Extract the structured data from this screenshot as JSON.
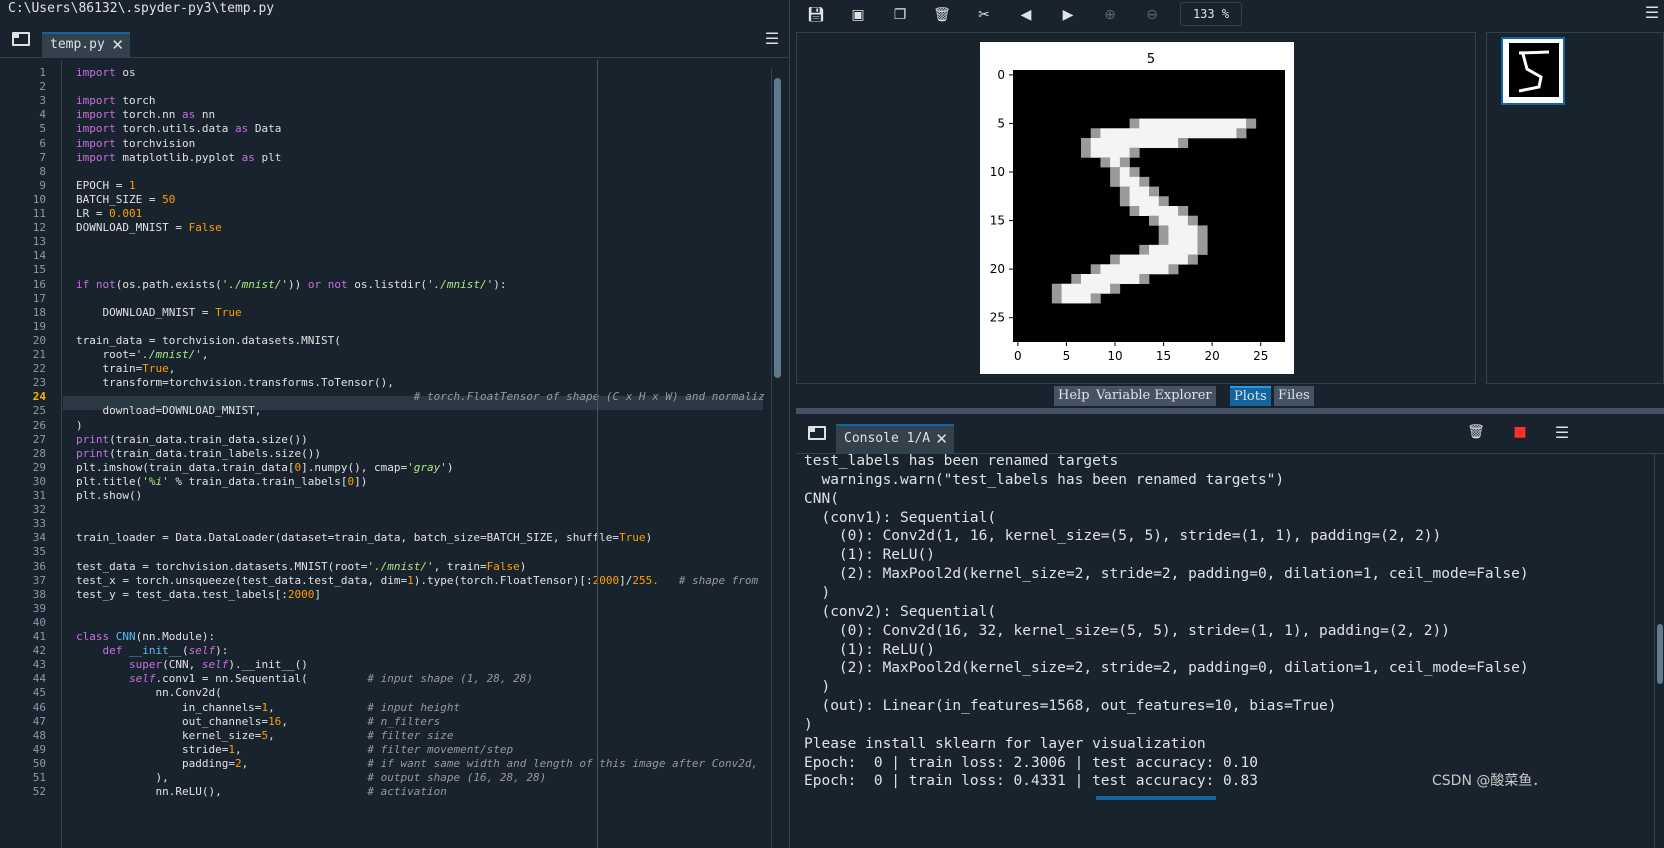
{
  "editor": {
    "path": "C:\\Users\\86132\\.spyder-py3\\temp.py",
    "tab_label": "temp.py",
    "current_line": 24,
    "lines": [
      [
        {
          "t": "import",
          "c": "kw"
        },
        {
          "t": " os"
        }
      ],
      [],
      [
        {
          "t": "import",
          "c": "kw"
        },
        {
          "t": " torch"
        }
      ],
      [
        {
          "t": "import",
          "c": "kw"
        },
        {
          "t": " torch.nn "
        },
        {
          "t": "as",
          "c": "kw"
        },
        {
          "t": " nn"
        }
      ],
      [
        {
          "t": "import",
          "c": "kw"
        },
        {
          "t": " torch.utils.data "
        },
        {
          "t": "as",
          "c": "kw"
        },
        {
          "t": " Data"
        }
      ],
      [
        {
          "t": "import",
          "c": "kw"
        },
        {
          "t": " torchvision"
        }
      ],
      [
        {
          "t": "import",
          "c": "kw"
        },
        {
          "t": " matplotlib.pyplot "
        },
        {
          "t": "as",
          "c": "kw"
        },
        {
          "t": " plt"
        }
      ],
      [],
      [
        {
          "t": "EPOCH = "
        },
        {
          "t": "1",
          "c": "num"
        }
      ],
      [
        {
          "t": "BATCH_SIZE = "
        },
        {
          "t": "50",
          "c": "num"
        }
      ],
      [
        {
          "t": "LR = "
        },
        {
          "t": "0.001",
          "c": "num"
        }
      ],
      [
        {
          "t": "DOWNLOAD_MNIST = "
        },
        {
          "t": "False",
          "c": "num"
        }
      ],
      [],
      [],
      [],
      [
        {
          "t": "if",
          "c": "kw"
        },
        {
          "t": " "
        },
        {
          "t": "not",
          "c": "kw"
        },
        {
          "t": "(os.path.exists("
        },
        {
          "t": "'./mnist/'",
          "c": "str"
        },
        {
          "t": ")) "
        },
        {
          "t": "or",
          "c": "kw"
        },
        {
          "t": " "
        },
        {
          "t": "not",
          "c": "kw"
        },
        {
          "t": " os.listdir("
        },
        {
          "t": "'./mnist/'",
          "c": "str"
        },
        {
          "t": "):"
        }
      ],
      [],
      [
        {
          "t": "    DOWNLOAD_MNIST = "
        },
        {
          "t": "True",
          "c": "num"
        }
      ],
      [],
      [
        {
          "t": "train_data = torchvision.datasets.MNIST("
        }
      ],
      [
        {
          "t": "    root="
        },
        {
          "t": "'./mnist/'",
          "c": "str"
        },
        {
          "t": ","
        }
      ],
      [
        {
          "t": "    train="
        },
        {
          "t": "True",
          "c": "num"
        },
        {
          "t": ","
        }
      ],
      [
        {
          "t": "    transform=torchvision.transforms.ToTensor(),"
        }
      ],
      [
        {
          "t": "                                                   "
        },
        {
          "t": "# torch.FloatTensor of shape (C x H x W) and normaliz",
          "c": "cm"
        }
      ],
      [
        {
          "t": "    download=DOWNLOAD_MNIST,"
        }
      ],
      [
        {
          "t": ")"
        }
      ],
      [
        {
          "t": "print",
          "c": "kw"
        },
        {
          "t": "(train_data.train_data.size())"
        }
      ],
      [
        {
          "t": "print",
          "c": "kw"
        },
        {
          "t": "(train_data.train_labels.size())"
        }
      ],
      [
        {
          "t": "plt.imshow(train_data.train_data["
        },
        {
          "t": "0",
          "c": "num"
        },
        {
          "t": "].numpy(), cmap="
        },
        {
          "t": "'gray'",
          "c": "str"
        },
        {
          "t": ")"
        }
      ],
      [
        {
          "t": "plt.title("
        },
        {
          "t": "'%i'",
          "c": "str"
        },
        {
          "t": " % train_data.train_labels["
        },
        {
          "t": "0",
          "c": "num"
        },
        {
          "t": "])"
        }
      ],
      [
        {
          "t": "plt.show()"
        }
      ],
      [],
      [],
      [
        {
          "t": "train_loader = Data.DataLoader(dataset=train_data, batch_size=BATCH_SIZE, shuffle="
        },
        {
          "t": "True",
          "c": "num"
        },
        {
          "t": ")"
        }
      ],
      [],
      [
        {
          "t": "test_data = torchvision.datasets.MNIST(root="
        },
        {
          "t": "'./mnist/'",
          "c": "str"
        },
        {
          "t": ", train="
        },
        {
          "t": "False",
          "c": "num"
        },
        {
          "t": ")"
        }
      ],
      [
        {
          "t": "test_x = torch.unsqueeze(test_data.test_data, dim="
        },
        {
          "t": "1",
          "c": "num"
        },
        {
          "t": ").type(torch.FloatTensor)[:"
        },
        {
          "t": "2000",
          "c": "num"
        },
        {
          "t": "]/"
        },
        {
          "t": "255.",
          "c": "num"
        },
        {
          "t": "   "
        },
        {
          "t": "# shape from",
          "c": "cm"
        }
      ],
      [
        {
          "t": "test_y = test_data.test_labels[:"
        },
        {
          "t": "2000",
          "c": "num"
        },
        {
          "t": "]"
        }
      ],
      [],
      [],
      [
        {
          "t": "class",
          "c": "kw"
        },
        {
          "t": " "
        },
        {
          "t": "CNN",
          "c": "cls"
        },
        {
          "t": "(nn.Module):"
        }
      ],
      [
        {
          "t": "    "
        },
        {
          "t": "def",
          "c": "kw"
        },
        {
          "t": " "
        },
        {
          "t": "__init__",
          "c": "cls"
        },
        {
          "t": "("
        },
        {
          "t": "self",
          "c": "self"
        },
        {
          "t": "):"
        }
      ],
      [
        {
          "t": "        "
        },
        {
          "t": "super",
          "c": "kw"
        },
        {
          "t": "(CNN, "
        },
        {
          "t": "self",
          "c": "self"
        },
        {
          "t": ").__init__()"
        }
      ],
      [
        {
          "t": "        "
        },
        {
          "t": "self",
          "c": "self"
        },
        {
          "t": ".conv1 = nn.Sequential(         "
        },
        {
          "t": "# input shape (1, 28, 28)",
          "c": "cm"
        }
      ],
      [
        {
          "t": "            nn.Conv2d("
        }
      ],
      [
        {
          "t": "                in_channels="
        },
        {
          "t": "1",
          "c": "num"
        },
        {
          "t": ",              "
        },
        {
          "t": "# input height",
          "c": "cm"
        }
      ],
      [
        {
          "t": "                out_channels="
        },
        {
          "t": "16",
          "c": "num"
        },
        {
          "t": ",            "
        },
        {
          "t": "# n_filters",
          "c": "cm"
        }
      ],
      [
        {
          "t": "                kernel_size="
        },
        {
          "t": "5",
          "c": "num"
        },
        {
          "t": ",              "
        },
        {
          "t": "# filter size",
          "c": "cm"
        }
      ],
      [
        {
          "t": "                stride="
        },
        {
          "t": "1",
          "c": "num"
        },
        {
          "t": ",                   "
        },
        {
          "t": "# filter movement/step",
          "c": "cm"
        }
      ],
      [
        {
          "t": "                padding="
        },
        {
          "t": "2",
          "c": "num"
        },
        {
          "t": ",                  "
        },
        {
          "t": "# if want same width and length of this image after Conv2d,",
          "c": "cm"
        }
      ],
      [
        {
          "t": "            ),                              "
        },
        {
          "t": "# output shape (16, 28, 28)",
          "c": "cm"
        }
      ],
      [
        {
          "t": "            nn.ReLU(),                      "
        },
        {
          "t": "# activation",
          "c": "cm"
        }
      ]
    ]
  },
  "plots": {
    "zoom": "133 %",
    "figure_title": "5",
    "x_ticks": [
      "0",
      "5",
      "10",
      "15",
      "20",
      "25"
    ],
    "y_ticks": [
      "0",
      "5",
      "10",
      "15",
      "20",
      "25"
    ],
    "tabs": [
      {
        "label": "Help",
        "active": false
      },
      {
        "label": "Variable Explorer",
        "active": false
      },
      {
        "label": "Plots",
        "active": true
      },
      {
        "label": "Files",
        "active": false
      }
    ],
    "digit_rows": [
      {
        "row": 5,
        "cols": [
          [
            12,
            24
          ]
        ]
      },
      {
        "row": 6,
        "cols": [
          [
            8,
            23
          ]
        ]
      },
      {
        "row": 7,
        "cols": [
          [
            7,
            17
          ]
        ]
      },
      {
        "row": 8,
        "cols": [
          [
            7,
            12
          ]
        ]
      },
      {
        "row": 9,
        "cols": [
          [
            9,
            11
          ]
        ]
      },
      {
        "row": 10,
        "cols": [
          [
            10,
            12
          ]
        ]
      },
      {
        "row": 11,
        "cols": [
          [
            10,
            13
          ]
        ]
      },
      {
        "row": 12,
        "cols": [
          [
            11,
            14
          ]
        ]
      },
      {
        "row": 13,
        "cols": [
          [
            11,
            15
          ]
        ]
      },
      {
        "row": 14,
        "cols": [
          [
            12,
            17
          ]
        ]
      },
      {
        "row": 15,
        "cols": [
          [
            14,
            18
          ]
        ]
      },
      {
        "row": 16,
        "cols": [
          [
            15,
            19
          ]
        ]
      },
      {
        "row": 17,
        "cols": [
          [
            15,
            19
          ]
        ]
      },
      {
        "row": 18,
        "cols": [
          [
            13,
            19
          ]
        ]
      },
      {
        "row": 19,
        "cols": [
          [
            10,
            18
          ]
        ]
      },
      {
        "row": 20,
        "cols": [
          [
            8,
            16
          ]
        ]
      },
      {
        "row": 21,
        "cols": [
          [
            6,
            13
          ]
        ]
      },
      {
        "row": 22,
        "cols": [
          [
            4,
            10
          ]
        ]
      },
      {
        "row": 23,
        "cols": [
          [
            4,
            8
          ]
        ]
      }
    ]
  },
  "console": {
    "tab_label": "Console 1/A",
    "lines": [
      "test_labels has been renamed targets",
      "  warnings.warn(\"test_labels has been renamed targets\")",
      "CNN(",
      "  (conv1): Sequential(",
      "    (0): Conv2d(1, 16, kernel_size=(5, 5), stride=(1, 1), padding=(2, 2))",
      "    (1): ReLU()",
      "    (2): MaxPool2d(kernel_size=2, stride=2, padding=0, dilation=1, ceil_mode=False)",
      "  )",
      "  (conv2): Sequential(",
      "    (0): Conv2d(16, 32, kernel_size=(5, 5), stride=(1, 1), padding=(2, 2))",
      "    (1): ReLU()",
      "    (2): MaxPool2d(kernel_size=2, stride=2, padding=0, dilation=1, ceil_mode=False)",
      "  )",
      "  (out): Linear(in_features=1568, out_features=10, bias=True)",
      ")",
      "Please install sklearn for layer visualization",
      "Epoch:  0 | train loss: 2.3006 | test accuracy: 0.10",
      "Epoch:  0 | train loss: 0.4331 | test accuracy: 0.83"
    ]
  },
  "watermark": "CSDN @酸菜鱼．"
}
